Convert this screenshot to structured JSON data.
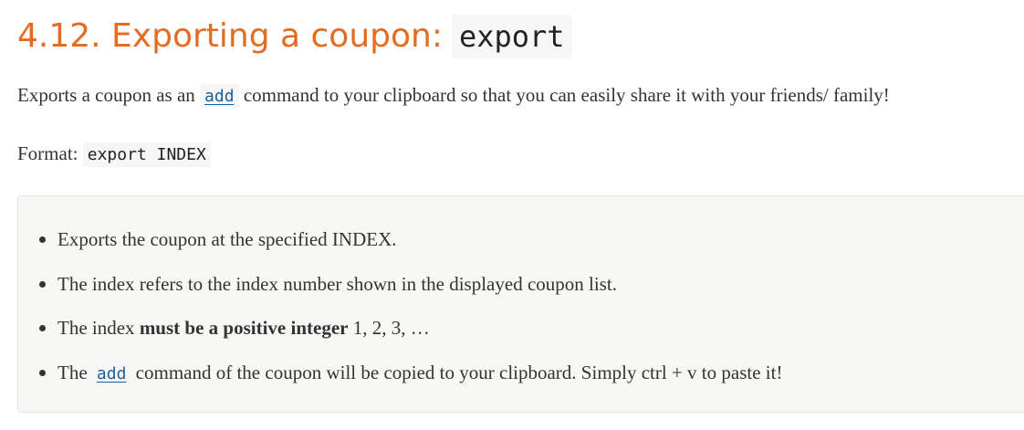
{
  "heading": {
    "text": "4.12. Exporting a coupon:",
    "code": "export"
  },
  "intro": {
    "before": "Exports a coupon as an",
    "code": "add",
    "after": "command to your clipboard so that you can easily share it with your friends/ family!"
  },
  "format": {
    "label": "Format:",
    "code_cmd": "export",
    "code_arg": "INDEX"
  },
  "notes": {
    "item1": "Exports the coupon at the specified INDEX.",
    "item2": "The index refers to the index number shown in the displayed coupon list.",
    "item3_before": "The index",
    "item3_bold": "must be a positive integer",
    "item3_after": "1, 2, 3, …",
    "item4_before": "The",
    "item4_code": "add",
    "item4_after": "command of the coupon will be copied to your clipboard. Simply ctrl + v to paste it!"
  },
  "colors": {
    "heading": "#e46c22",
    "link_code": "#1a5f9e",
    "box_background": "#f7f7f5"
  }
}
